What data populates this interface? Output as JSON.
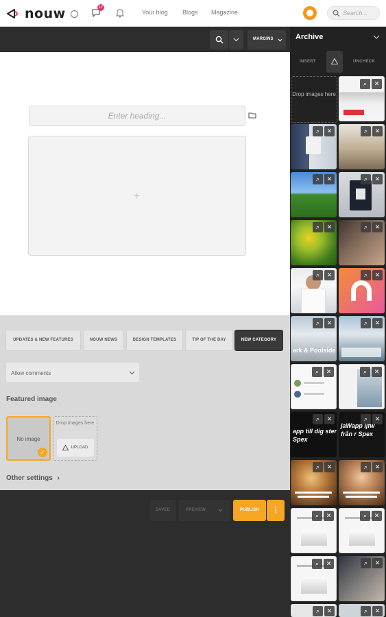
{
  "nav": {
    "logo": "nouw",
    "notification_count": "17",
    "links": [
      "Your blog",
      "Blogs",
      "Magazine"
    ],
    "search_placeholder": "Search..."
  },
  "toolbar": {
    "margins_label": "MARGINS"
  },
  "editor": {
    "heading_placeholder": "Enter heading..."
  },
  "settings": {
    "categories": [
      "UPDATES & NEW FEATURES",
      "NOUW NEWS",
      "DESIGN TEMPLATES",
      "TIP OF THE DAY",
      "NEW CATEGORY"
    ],
    "comments_select": "Allow comments",
    "featured_title": "Featured image",
    "no_image": "No image",
    "drop_text": "Drop images here",
    "upload_label": "UPLOAD",
    "other_settings": "Other settings"
  },
  "bottombar": {
    "saved": "SAVED",
    "preview": "PREVIEW",
    "publish": "PUBLISH"
  },
  "archive": {
    "title": "Archive",
    "insert": "INSERT",
    "uncheck": "UNCHECK",
    "drop_text": "Drop images here",
    "thumb_texts": {
      "poolside": "ark & Poolside",
      "app": "app till dig ster Spex",
      "app2": "jaWapp ljfw från r Spex"
    }
  },
  "colors": {
    "accent": "#f5a623",
    "brand_pink": "#e8336b",
    "dark": "#2d2d2d"
  }
}
